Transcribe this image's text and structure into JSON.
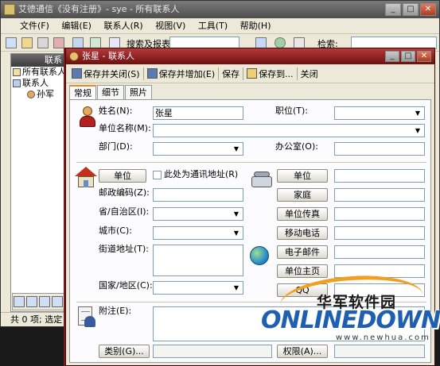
{
  "main_window": {
    "title": "艾德通信《没有注册》- sye - 所有联系人",
    "menu": [
      "文件(F)",
      "编辑(E)",
      "联系人(R)",
      "视图(V)",
      "工具(T)",
      "帮助(H)"
    ],
    "toolbar": {
      "search_label": "搜索及报表",
      "find_label": "检索:"
    },
    "sidebar": {
      "header": "联系",
      "items": [
        {
          "label": "所有联系人"
        },
        {
          "label": "联系人"
        },
        {
          "label": "孙军"
        }
      ]
    },
    "status": "共 0 项; 选定"
  },
  "dialog": {
    "title": "张星 - 联系人",
    "toolbar": {
      "save_close": "保存并关闭(S)",
      "save_add": "保存并增加(E)",
      "save": "保存",
      "save_to": "保存到...",
      "close": "关闭"
    },
    "tabs": [
      "常规",
      "细节",
      "照片"
    ],
    "active_tab": "常规",
    "form": {
      "name_label": "姓名(N):",
      "name_value": "张星",
      "title_label": "职位(T):",
      "company_label": "单位名称(M):",
      "department_label": "部门(D):",
      "office_label": "办公室(O):",
      "address_type_button": "单位",
      "mailing_address_label": "此处为通讯地址(R)",
      "postal_code_label": "邮政编码(Z):",
      "province_label": "省/自治区(I):",
      "city_label": "城市(C):",
      "street_label": "街道地址(T):",
      "country_label": "国家/地区(C):",
      "phone_buttons": [
        "单位",
        "家庭",
        "单位传真",
        "移动电话",
        "电子邮件",
        "单位主页",
        "QQ"
      ],
      "notes_label": "附注(E):",
      "category_button": "类别(G)...",
      "permission_button": "权限(A)..."
    }
  },
  "watermark": {
    "chinese": "华军软件园",
    "logo": "ONLINEDOWN",
    "url": "www.newhua.com"
  },
  "colors": {
    "dialog_title_bar": "#8e1f1f",
    "window_title_bar": "#5a5a5a",
    "face": "#ece9d8",
    "input_border": "#7f9db9",
    "logo_blue": "#1f5fb0",
    "logo_arc": "#f0a020"
  }
}
